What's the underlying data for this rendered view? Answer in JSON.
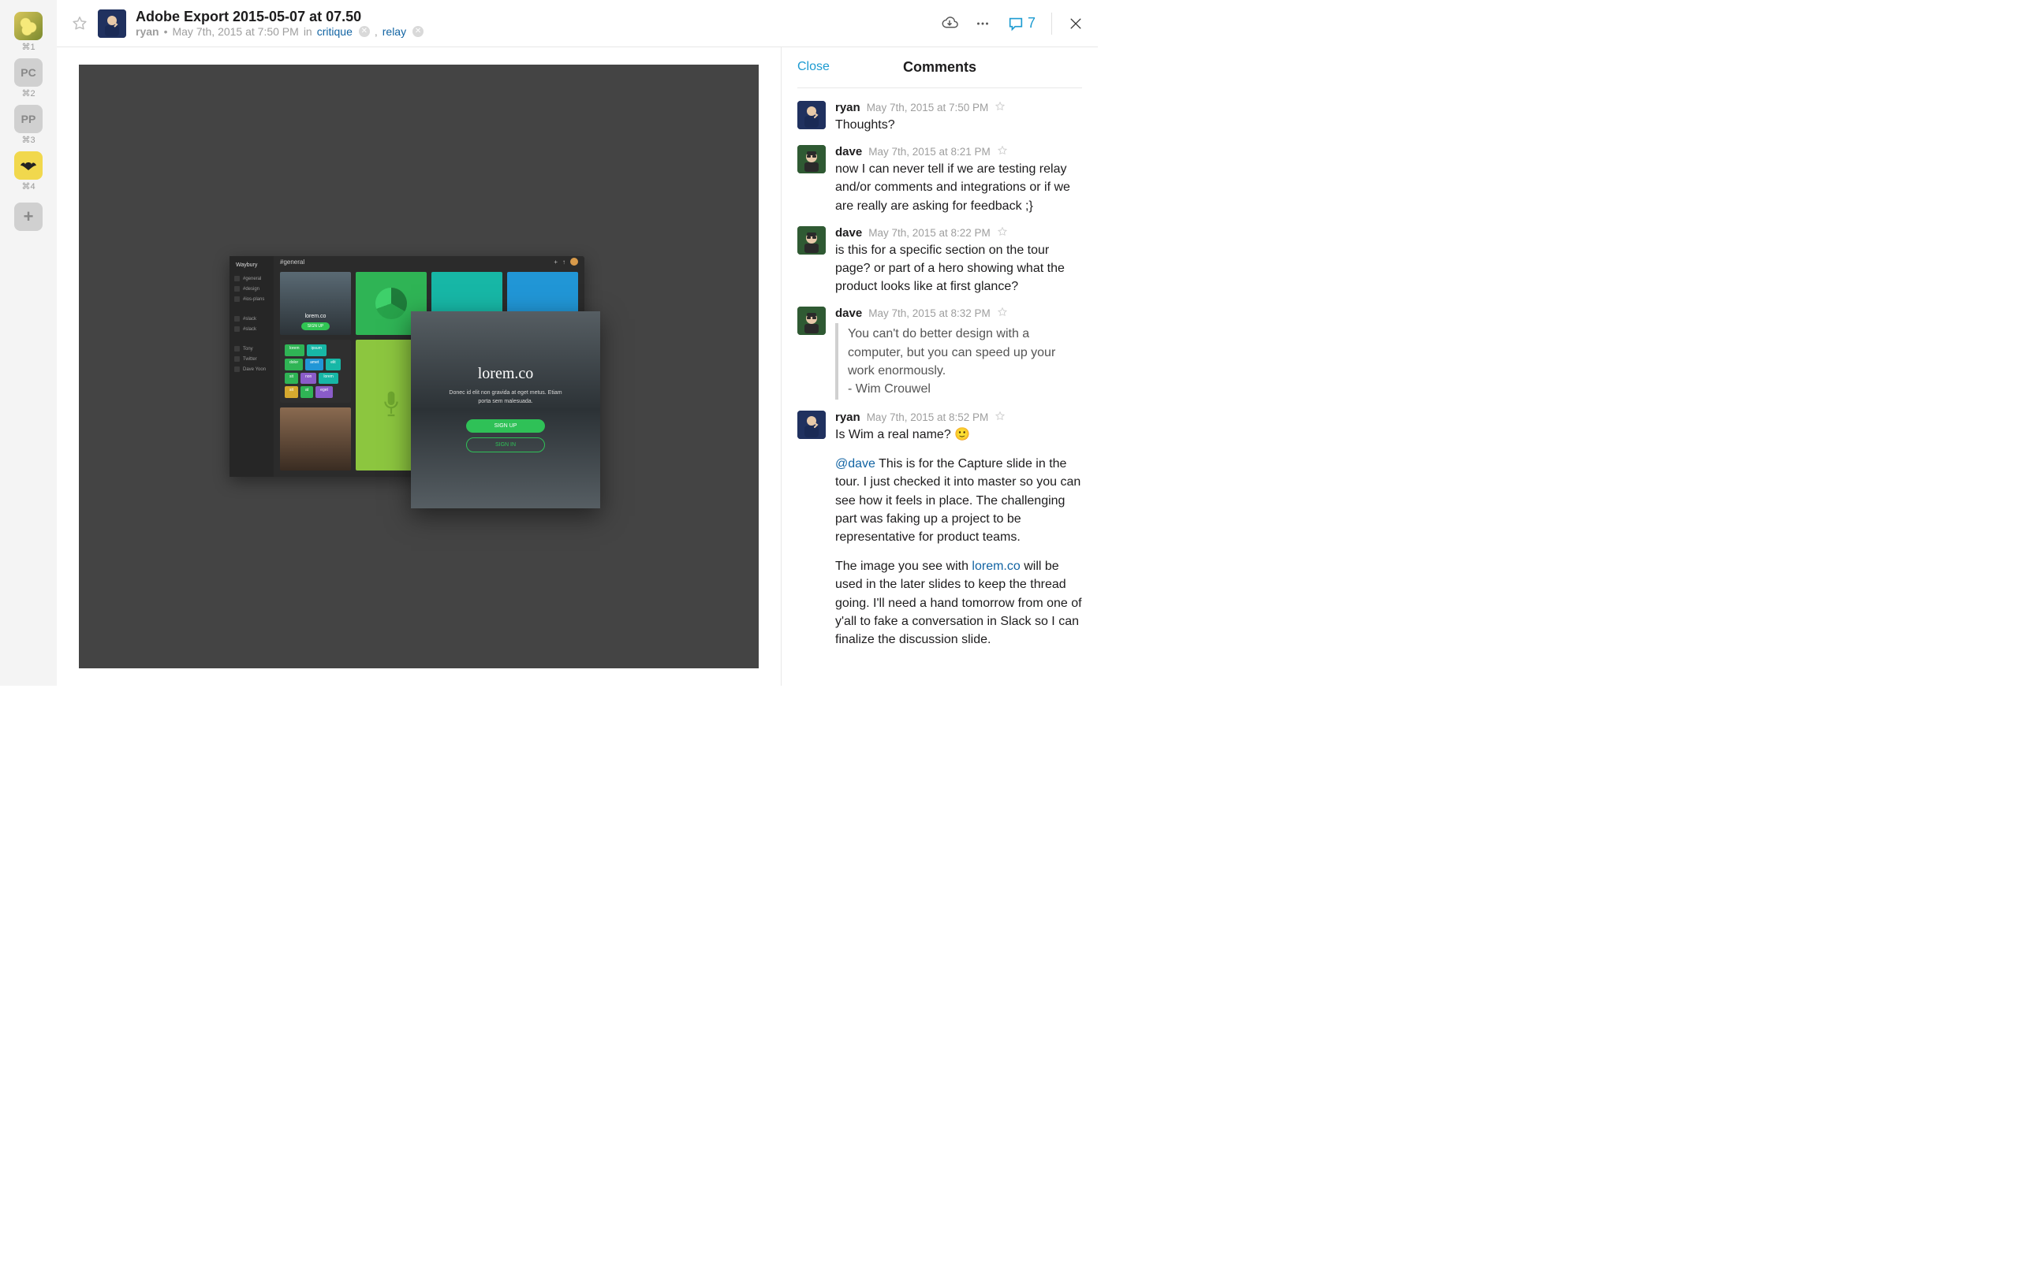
{
  "rail": {
    "items": [
      {
        "kind": "image",
        "shortcut": "⌘1"
      },
      {
        "kind": "letters",
        "label": "PC",
        "shortcut": "⌘2"
      },
      {
        "kind": "letters",
        "label": "PP",
        "shortcut": "⌘3"
      },
      {
        "kind": "batman",
        "shortcut": "⌘4"
      }
    ],
    "add_label": "+"
  },
  "topbar": {
    "title": "Adobe Export 2015-05-07 at 07.50",
    "author": "ryan",
    "timestamp": "May 7th, 2015 at 7:50 PM",
    "in_word": "in",
    "channels": [
      "critique",
      "relay"
    ],
    "comment_count": "7"
  },
  "panel": {
    "close": "Close",
    "title": "Comments"
  },
  "mock": {
    "brand": "Waybury",
    "head_channel": "#general",
    "side": {
      "groups": [
        {
          "rows": [
            "#general",
            "#design",
            "#ios-plans"
          ]
        },
        {
          "rows": [
            "#slack",
            "#slack"
          ]
        },
        {
          "rows": [
            "Tony",
            "Twitter",
            "Dave Yoon"
          ]
        }
      ]
    },
    "tile_label": "lorem.co",
    "tile_button": "SIGN UP",
    "hero": {
      "title": "lorem.co",
      "body": "Donec id elit non gravida at eget metus. Etiam porta sem malesuada.",
      "primary": "SIGN UP",
      "secondary": "SIGN IN"
    }
  },
  "comments": [
    {
      "author": "ryan",
      "avatar": "ryan",
      "time": "May 7th, 2015 at 7:50 PM",
      "content": [
        {
          "type": "text",
          "value": "Thoughts?"
        }
      ]
    },
    {
      "author": "dave",
      "avatar": "dave",
      "time": "May 7th, 2015 at 8:21 PM",
      "content": [
        {
          "type": "text",
          "value": "now I can never tell if we are testing relay and/or comments and integrations or if we are really are asking for feedback ;}"
        }
      ]
    },
    {
      "author": "dave",
      "avatar": "dave",
      "time": "May 7th, 2015 at 8:22 PM",
      "content": [
        {
          "type": "text",
          "value": "is this for a specific section on the tour page? or part of a hero showing what the product looks like at first glance?"
        }
      ]
    },
    {
      "author": "dave",
      "avatar": "dave",
      "time": "May 7th, 2015 at 8:32 PM",
      "content": [
        {
          "type": "quote",
          "value": "You can't do better design with a computer, but you can speed up your work enormously.\n- Wim Crouwel"
        }
      ]
    },
    {
      "author": "ryan",
      "avatar": "ryan",
      "time": "May 7th, 2015 at 8:52 PM",
      "content": [
        {
          "type": "rich",
          "spans": [
            {
              "t": "text",
              "v": "Is Wim a real name? "
            },
            {
              "t": "emoji",
              "v": "🙂"
            }
          ]
        },
        {
          "type": "rich",
          "spans": [
            {
              "t": "mention",
              "v": "@dave"
            },
            {
              "t": "text",
              "v": " This is for the Capture slide in the tour. I just checked it into master so you can see how it feels in place.  The challenging part was faking up a project to be representative for product teams."
            }
          ]
        },
        {
          "type": "rich",
          "spans": [
            {
              "t": "text",
              "v": "The image you see with "
            },
            {
              "t": "link",
              "v": "lorem.co"
            },
            {
              "t": "text",
              "v": " will be used in the later slides to keep the thread going. I'll need a hand tomorrow from one of y'all to fake a conversation in Slack so I can finalize the discussion slide."
            }
          ]
        }
      ]
    }
  ]
}
